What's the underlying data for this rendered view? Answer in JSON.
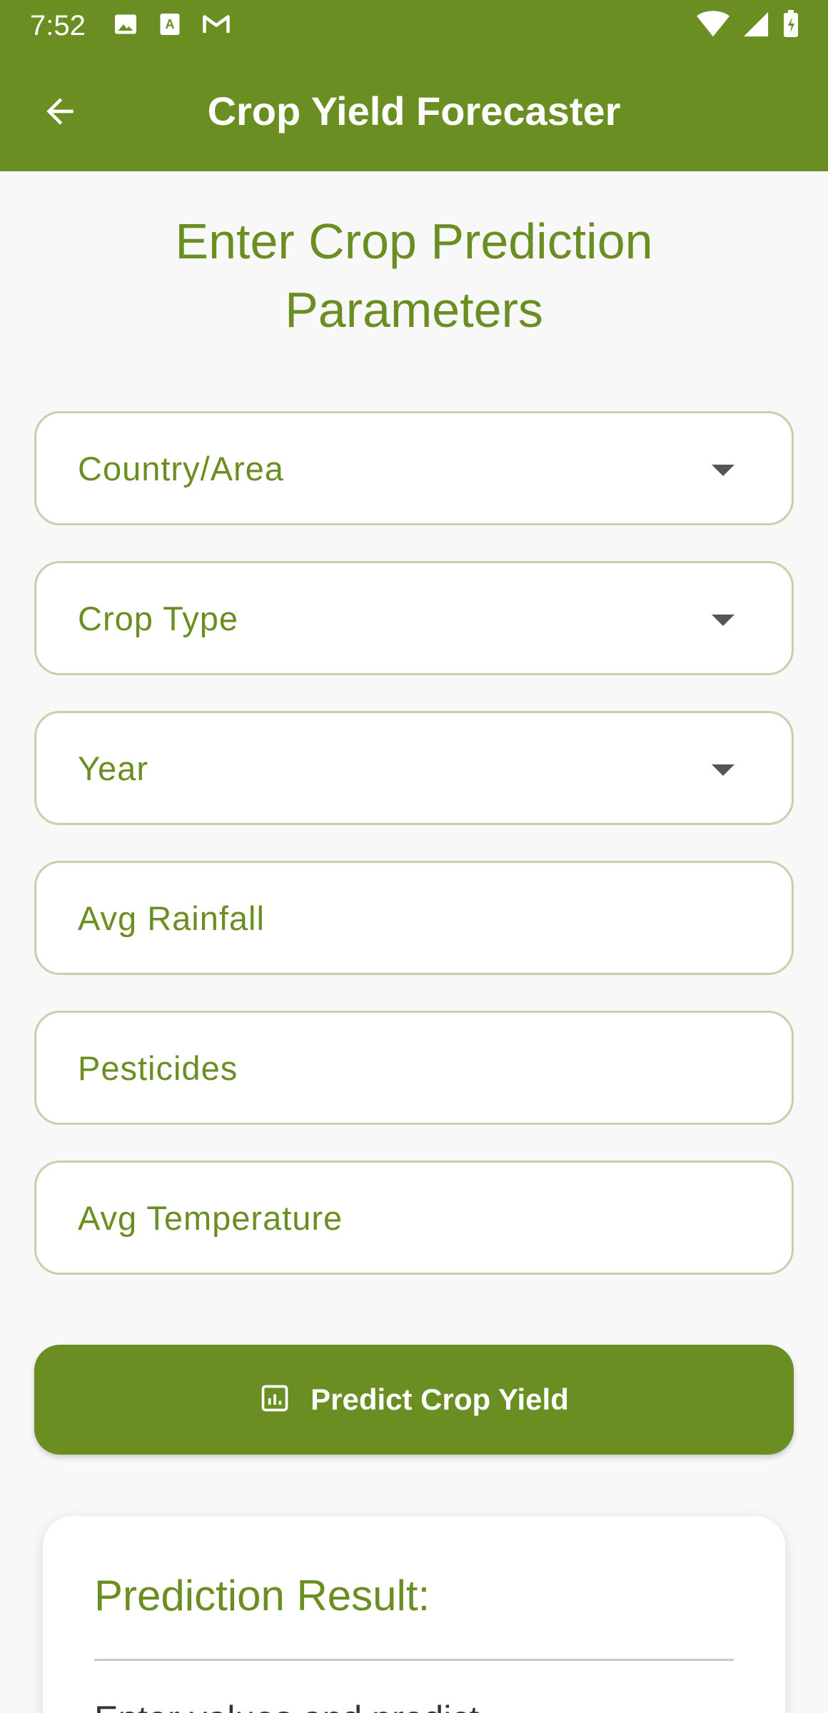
{
  "status_bar": {
    "time": "7:52",
    "left_icons": [
      "image-icon",
      "text-a-icon",
      "gmail-icon"
    ],
    "right_icons": [
      "wifi-icon",
      "cell-signal-icon",
      "battery-charging-icon"
    ]
  },
  "app_bar": {
    "title": "Crop Yield Forecaster",
    "back_icon": "arrow-back-icon"
  },
  "heading": "Enter Crop Prediction Parameters",
  "form": {
    "country": {
      "label": "Country/Area",
      "type": "dropdown"
    },
    "crop_type": {
      "label": "Crop Type",
      "type": "dropdown"
    },
    "year": {
      "label": "Year",
      "type": "dropdown"
    },
    "avg_rainfall": {
      "label": "Avg Rainfall",
      "type": "text"
    },
    "pesticides": {
      "label": "Pesticides",
      "type": "text"
    },
    "avg_temperature": {
      "label": "Avg Temperature",
      "type": "text"
    }
  },
  "predict_button": {
    "label": "Predict Crop Yield",
    "icon": "chart-icon"
  },
  "result": {
    "title": "Prediction Result:",
    "text": "Enter values and predict"
  },
  "colors": {
    "primary": "#6b8e23",
    "background": "#f8f8f8",
    "field_border": "#c8cfaa"
  }
}
